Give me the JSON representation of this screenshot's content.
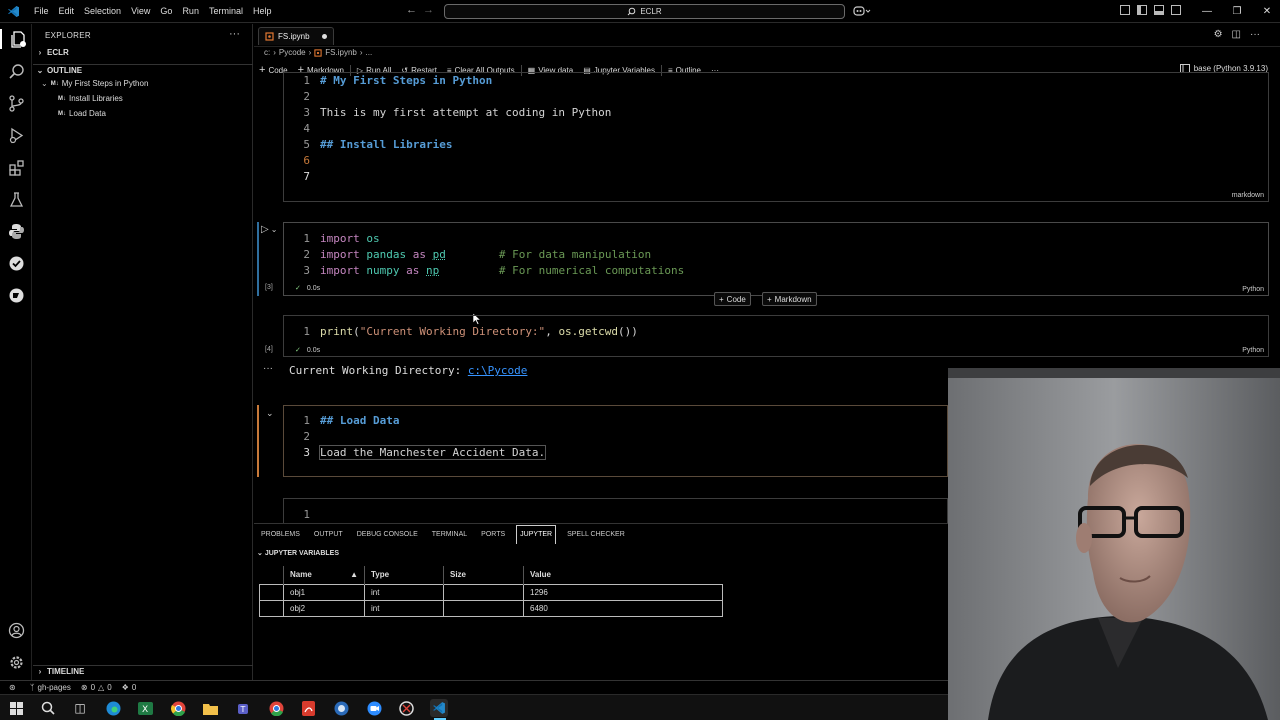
{
  "menu": [
    "File",
    "Edit",
    "Selection",
    "View",
    "Go",
    "Run",
    "Terminal",
    "Help"
  ],
  "command_center": {
    "text": "ECLR"
  },
  "sidebar": {
    "title": "EXPLORER",
    "workspace": "ECLR",
    "outline": {
      "title": "OUTLINE",
      "items": [
        {
          "badge": "M↓",
          "label": "My First Steps in Python"
        },
        {
          "badge": "M↓",
          "label": "Install Libraries"
        },
        {
          "badge": "M↓",
          "label": "Load Data"
        }
      ]
    },
    "timeline": "TIMELINE"
  },
  "tab": {
    "label": "FS.ipynb"
  },
  "breadcrumb": [
    "c:",
    "Pycode",
    "FS.ipynb",
    "..."
  ],
  "toolbar": {
    "code": "Code",
    "markdown": "Markdown",
    "run_all": "Run All",
    "restart": "Restart",
    "clear_all": "Clear All Outputs",
    "view_data": "View data",
    "jupyter_variables": "Jupyter Variables",
    "outline": "Outline",
    "more": "···"
  },
  "kernel": "base (Python 3.9.13)",
  "cell1": {
    "lang": "markdown",
    "lines": [
      "# My First Steps in Python",
      "",
      "This is my first attempt at coding in Python",
      "",
      "## Install Libraries",
      "",
      ""
    ]
  },
  "cell2": {
    "exec_count": "[3]",
    "time": "0.0s",
    "lang": "Python",
    "kw_import": "import",
    "kw_as": "as",
    "line1_mod": "os",
    "line2_mod": "pandas",
    "line2_alias": "pd",
    "line2_comment": "# For data manipulation",
    "line3_mod": "numpy",
    "line3_alias": "np",
    "line3_comment": "# For numerical computations"
  },
  "insert": {
    "code": "Code",
    "markdown": "Markdown"
  },
  "cell3": {
    "exec_count": "[4]",
    "time": "0.0s",
    "lang": "Python",
    "fn": "print",
    "string": "\"Current Working Directory:\"",
    "call": "os.getcwd",
    "output_label": "Current Working Directory:",
    "output_link": "c:\\Pycode"
  },
  "cell4": {
    "lines": [
      "## Load Data",
      "",
      "Load the Manchester Accident Data."
    ]
  },
  "cell5": {
    "line": "1"
  },
  "panel": {
    "tabs": [
      "PROBLEMS",
      "OUTPUT",
      "DEBUG CONSOLE",
      "TERMINAL",
      "PORTS",
      "JUPYTER",
      "SPELL CHECKER"
    ],
    "active_tab": "JUPYTER",
    "section": "JUPYTER VARIABLES",
    "columns": [
      "Name",
      "Type",
      "Size",
      "Value"
    ],
    "rows": [
      {
        "name": "obj1",
        "type": "int",
        "size": "",
        "value": "1296"
      },
      {
        "name": "obj2",
        "type": "int",
        "size": "",
        "value": "6480"
      }
    ]
  },
  "statusbar": {
    "branch": "gh-pages",
    "errors": "0",
    "warnings": "0",
    "ports": "0"
  },
  "colors": {
    "accent_link": "#3794ff",
    "keyword": "#c586c0",
    "string": "#ce9178",
    "comment": "#6a9955",
    "heading": "#569cd6"
  }
}
